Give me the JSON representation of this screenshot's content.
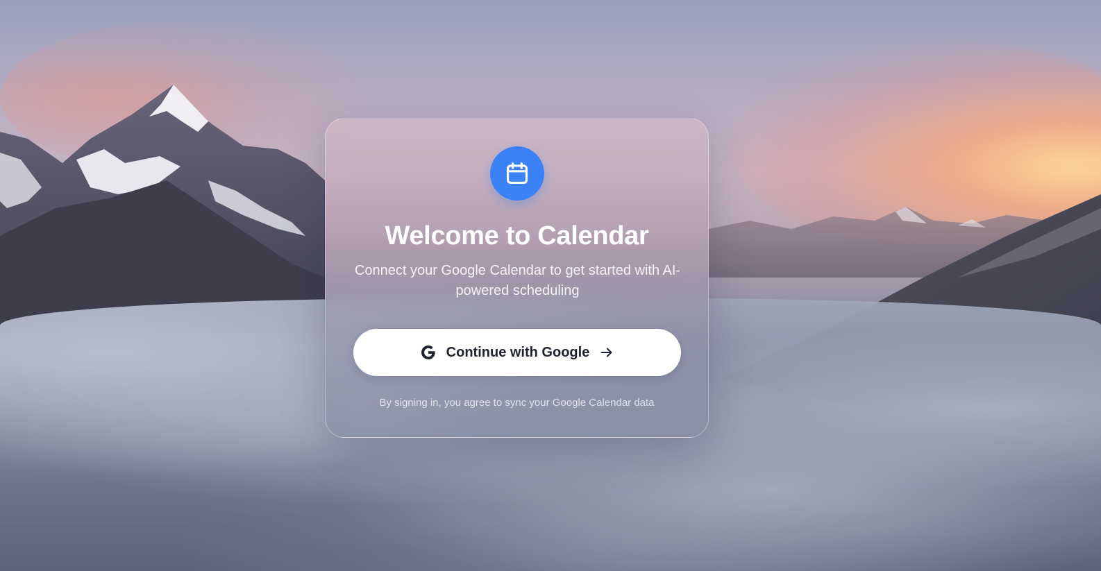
{
  "app": {
    "title": "Welcome to Calendar",
    "subtitle": "Connect your Google Calendar to get started with AI-powered scheduling"
  },
  "signin": {
    "button_label": "Continue with Google",
    "button_icon": "google-g-icon",
    "trailing_icon": "arrow-right-icon",
    "disclaimer": "By signing in, you agree to sync your Google Calendar data"
  },
  "logo": {
    "icon": "calendar-icon",
    "color": "#3b82f6"
  },
  "background": {
    "description_icon": "mountain-landscape-image"
  }
}
